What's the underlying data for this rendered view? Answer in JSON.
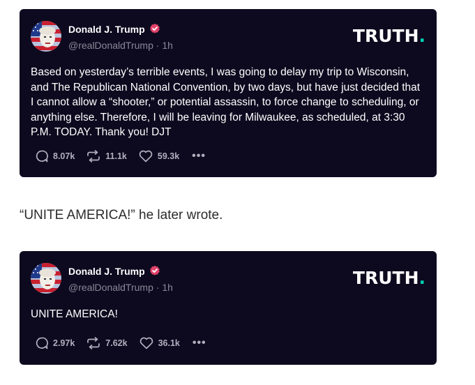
{
  "posts": [
    {
      "author_name": "Donald J. Trump",
      "handle": "@realDonaldTrump",
      "time": "1h",
      "logo_text": "TRUTH",
      "logo_dot": ".",
      "text": "Based on yesterday’s terrible events, I was going to delay my trip to Wisconsin, and The Republican National Convention, by two days, but have just decided that I cannot allow a “shooter,” or potential assassin, to force change to scheduling, or anything else. Therefore, I will be leaving for Milwaukee, as scheduled, at 3:30 P.M. TODAY. Thank you!  DJT",
      "replies": "8.07k",
      "retruths": "11.1k",
      "likes": "59.3k",
      "more": "•••"
    },
    {
      "author_name": "Donald J. Trump",
      "handle": "@realDonaldTrump",
      "time": "1h",
      "logo_text": "TRUTH",
      "logo_dot": ".",
      "text": "UNITE AMERICA!",
      "replies": "2.97k",
      "retruths": "7.62k",
      "likes": "36.1k",
      "more": "•••"
    }
  ],
  "between_text": "“UNITE AMERICA!” he later wrote.",
  "colors": {
    "card_bg": "#0d0a1f",
    "logo_accent": "#00d3b6",
    "verified": "#e2436b",
    "muted": "#8b8798"
  },
  "icons": [
    "reply-icon",
    "retruth-icon",
    "like-icon",
    "verified-icon",
    "more-icon"
  ]
}
